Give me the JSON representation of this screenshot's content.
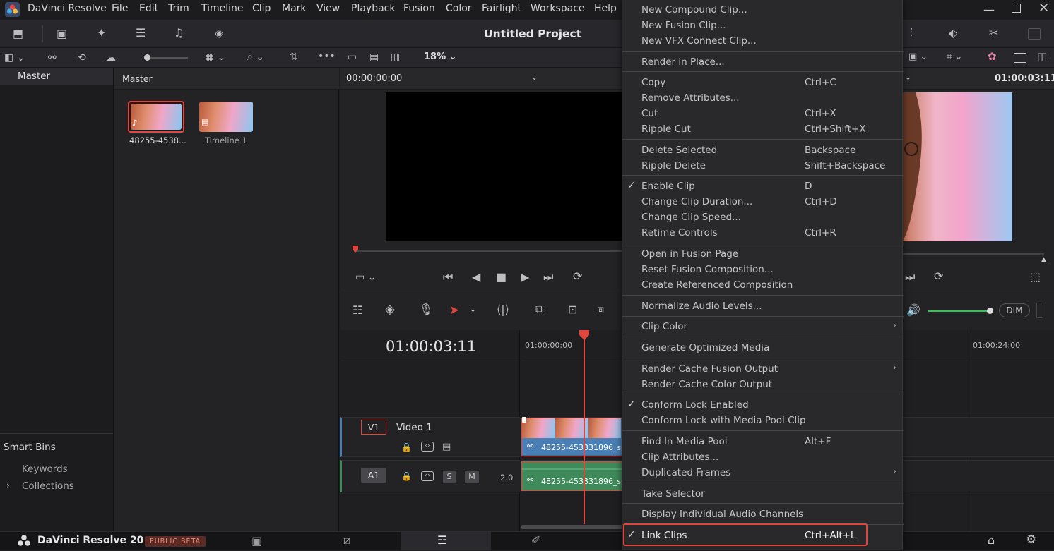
{
  "app": {
    "name": "DaVinci Resolve",
    "menus": [
      "File",
      "Edit",
      "Trim",
      "Timeline",
      "Clip",
      "Mark",
      "View",
      "Playback",
      "Fusion",
      "Color",
      "Fairlight",
      "Workspace",
      "Help"
    ],
    "project_title": "Untitled Project"
  },
  "toolbar2": {
    "zoom": "18%"
  },
  "left_panel": {
    "master_label": "Master",
    "smart_bins_label": "Smart Bins",
    "smart_bins": [
      "Keywords",
      "Collections"
    ]
  },
  "bin": {
    "header": "Master",
    "items": [
      {
        "name": "48255-4538...",
        "type": "clip"
      },
      {
        "name": "Timeline 1",
        "type": "timeline"
      }
    ]
  },
  "source_viewer": {
    "timecode": "00:00:00:00"
  },
  "timeline_viewer": {
    "timecode": "01:00:03:11"
  },
  "timeline": {
    "current_timecode": "01:00:03:11",
    "ruler_start": "01:00:00:00",
    "ruler_end": "01:00:24:00",
    "video_track": {
      "id": "V1",
      "name": "Video 1",
      "clip_name": "48255-453331896_s"
    },
    "audio_track": {
      "id": "A1",
      "level": "2.0",
      "solo": "S",
      "mute": "M",
      "clip_name": "48255-453331896_s"
    },
    "dim_label": "DIM"
  },
  "context_menu": {
    "groups": [
      [
        {
          "label": "New Compound Clip...",
          "shortcut": "",
          "checked": false,
          "submenu": false
        },
        {
          "label": "New Fusion Clip...",
          "shortcut": "",
          "checked": false,
          "submenu": false
        },
        {
          "label": "New VFX Connect Clip...",
          "shortcut": "",
          "checked": false,
          "submenu": false
        }
      ],
      [
        {
          "label": "Render in Place...",
          "shortcut": "",
          "checked": false,
          "submenu": false
        }
      ],
      [
        {
          "label": "Copy",
          "shortcut": "Ctrl+C",
          "checked": false,
          "submenu": false
        },
        {
          "label": "Remove Attributes...",
          "shortcut": "",
          "checked": false,
          "submenu": false
        },
        {
          "label": "Cut",
          "shortcut": "Ctrl+X",
          "checked": false,
          "submenu": false
        },
        {
          "label": "Ripple Cut",
          "shortcut": "Ctrl+Shift+X",
          "checked": false,
          "submenu": false
        }
      ],
      [
        {
          "label": "Delete Selected",
          "shortcut": "Backspace",
          "checked": false,
          "submenu": false
        },
        {
          "label": "Ripple Delete",
          "shortcut": "Shift+Backspace",
          "checked": false,
          "submenu": false
        }
      ],
      [
        {
          "label": "Enable Clip",
          "shortcut": "D",
          "checked": true,
          "submenu": false
        },
        {
          "label": "Change Clip Duration...",
          "shortcut": "Ctrl+D",
          "checked": false,
          "submenu": false
        },
        {
          "label": "Change Clip Speed...",
          "shortcut": "",
          "checked": false,
          "submenu": false
        },
        {
          "label": "Retime Controls",
          "shortcut": "Ctrl+R",
          "checked": false,
          "submenu": false
        }
      ],
      [
        {
          "label": "Open in Fusion Page",
          "shortcut": "",
          "checked": false,
          "submenu": false
        },
        {
          "label": "Reset Fusion Composition...",
          "shortcut": "",
          "checked": false,
          "submenu": false
        },
        {
          "label": "Create Referenced Composition",
          "shortcut": "",
          "checked": false,
          "submenu": false
        }
      ],
      [
        {
          "label": "Normalize Audio Levels...",
          "shortcut": "",
          "checked": false,
          "submenu": false
        }
      ],
      [
        {
          "label": "Clip Color",
          "shortcut": "",
          "checked": false,
          "submenu": true
        }
      ],
      [
        {
          "label": "Generate Optimized Media",
          "shortcut": "",
          "checked": false,
          "submenu": false
        }
      ],
      [
        {
          "label": "Render Cache Fusion Output",
          "shortcut": "",
          "checked": false,
          "submenu": true
        },
        {
          "label": "Render Cache Color Output",
          "shortcut": "",
          "checked": false,
          "submenu": false
        }
      ],
      [
        {
          "label": "Conform Lock Enabled",
          "shortcut": "",
          "checked": true,
          "submenu": false
        },
        {
          "label": "Conform Lock with Media Pool Clip",
          "shortcut": "",
          "checked": false,
          "submenu": false
        }
      ],
      [
        {
          "label": "Find In Media Pool",
          "shortcut": "Alt+F",
          "checked": false,
          "submenu": false
        },
        {
          "label": "Clip Attributes...",
          "shortcut": "",
          "checked": false,
          "submenu": false
        },
        {
          "label": "Duplicated Frames",
          "shortcut": "",
          "checked": false,
          "submenu": true
        }
      ],
      [
        {
          "label": "Take Selector",
          "shortcut": "",
          "checked": false,
          "submenu": false
        }
      ],
      [
        {
          "label": "Display Individual Audio Channels",
          "shortcut": "",
          "checked": false,
          "submenu": false
        }
      ],
      [
        {
          "label": "Link Clips",
          "shortcut": "Ctrl+Alt+L",
          "checked": true,
          "submenu": false,
          "highlighted": true
        }
      ]
    ]
  },
  "bottom": {
    "brand": "DaVinci Resolve 20",
    "badge": "PUBLIC BETA"
  },
  "colors": {
    "accent_red": "#e0463d",
    "video_clip": "#4a7fb5",
    "audio_clip": "#3f8a5a",
    "highlight_box": "#e0463d"
  }
}
